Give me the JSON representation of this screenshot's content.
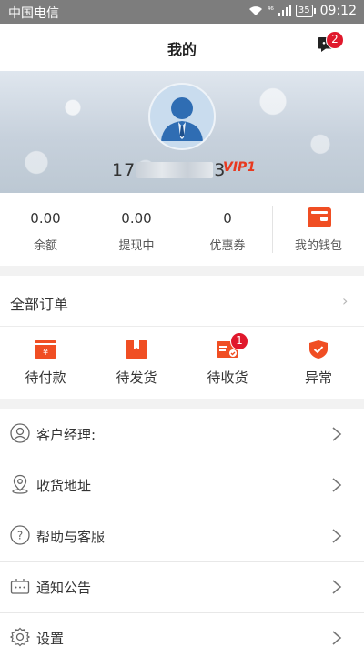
{
  "status_bar": {
    "carrier": "中国电信",
    "network": "⁴⁶",
    "battery": "35",
    "time": "09:12"
  },
  "header": {
    "title": "我的",
    "message_badge": "2",
    "message_icon": "chat-bubble-icon"
  },
  "profile": {
    "phone_prefix": "17",
    "phone_suffix": "3",
    "vip": "VIP1"
  },
  "stats": [
    {
      "value": "0.00",
      "label": "余额"
    },
    {
      "value": "0.00",
      "label": "提现中"
    },
    {
      "value": "0",
      "label": "优惠券"
    }
  ],
  "wallet": {
    "label": "我的钱包",
    "icon": "wallet-icon"
  },
  "orders": {
    "title": "全部订单",
    "more": "›",
    "items": [
      {
        "label": "待付款",
        "icon": "yen-card-icon"
      },
      {
        "label": "待发货",
        "icon": "package-icon"
      },
      {
        "label": "待收货",
        "icon": "delivery-card-icon",
        "badge": "1"
      },
      {
        "label": "异常",
        "icon": "shield-check-icon"
      }
    ]
  },
  "menu": [
    {
      "label": "客户经理:",
      "icon": "person-icon"
    },
    {
      "label": "收货地址",
      "icon": "location-pin-icon"
    },
    {
      "label": "帮助与客服",
      "icon": "question-icon"
    },
    {
      "label": "通知公告",
      "icon": "notice-box-icon"
    },
    {
      "label": "设置",
      "icon": "gear-icon"
    }
  ],
  "colors": {
    "accent": "#f04e23",
    "badge": "#e0182c",
    "status_bar": "#7d7d7d"
  }
}
